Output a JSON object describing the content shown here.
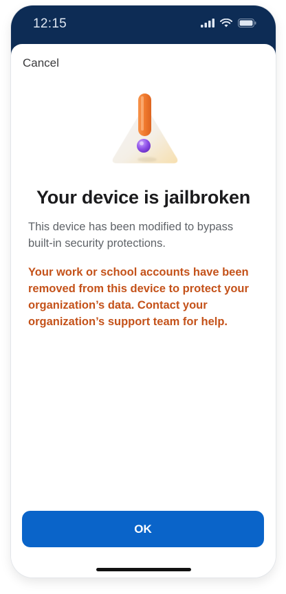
{
  "status_bar": {
    "time": "12:15",
    "icons": [
      "signal-icon",
      "wifi-icon",
      "battery-icon"
    ]
  },
  "header": {
    "cancel_label": "Cancel"
  },
  "hero": {
    "icon": "warning-exclamation-icon"
  },
  "content": {
    "title": "Your device is jailbroken",
    "description": "This device has been modified to bypass built-in security protections.",
    "warning": "Your work or school accounts have been removed from this device to protect your organization’s data. Contact your organization’s support team for help."
  },
  "actions": {
    "ok_label": "OK"
  },
  "colors": {
    "status_bar": "#0d2c55",
    "primary": "#0a64c9",
    "warning_text": "#c4521a",
    "exclamation": "#f07a2e",
    "dot": "#8b4de6"
  }
}
